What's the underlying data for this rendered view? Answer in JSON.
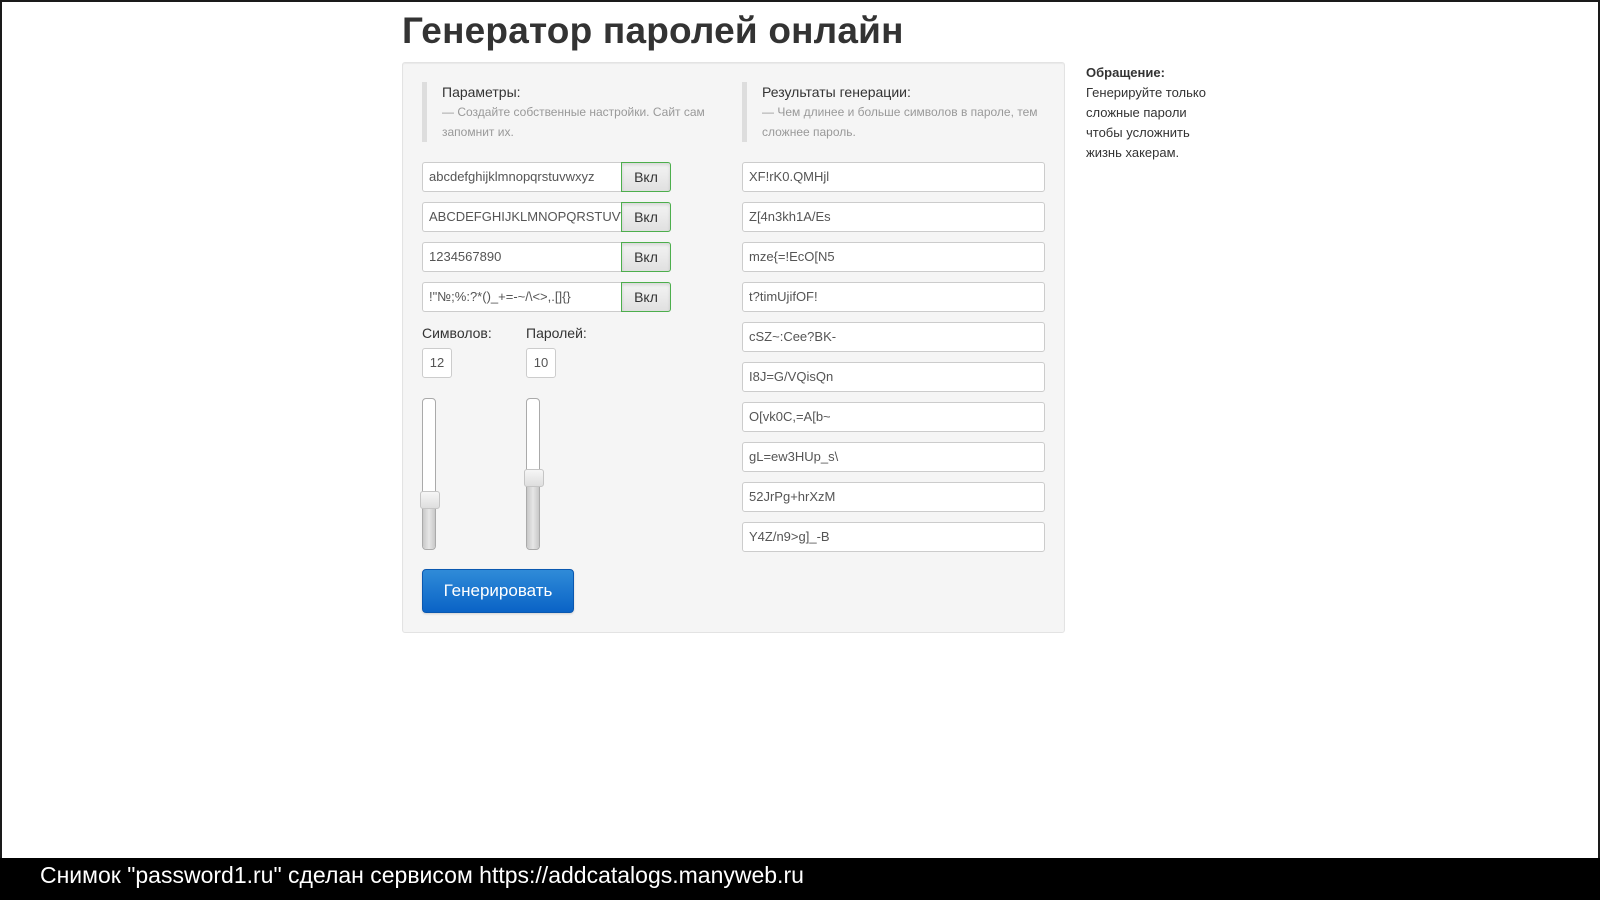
{
  "page": {
    "title": "Генератор паролей онлайн"
  },
  "params": {
    "title": "Параметры:",
    "subtitle": "— Создайте собственные настройки. Сайт сам запомнит их.",
    "charsets": [
      {
        "value": "abcdefghijklmnopqrstuvwxyz",
        "toggle_label": "Вкл"
      },
      {
        "value": "ABCDEFGHIJKLMNOPQRSTUVWXYZ",
        "toggle_label": "Вкл"
      },
      {
        "value": "1234567890",
        "toggle_label": "Вкл"
      },
      {
        "value": "!\"№;%:?*()_+=-~/\\<>,.[]{}",
        "toggle_label": "Вкл"
      }
    ],
    "length_label": "Символов:",
    "length_value": "12",
    "length_slider_fraction": 0.3,
    "count_label": "Паролей:",
    "count_value": "10",
    "count_slider_fraction": 0.47,
    "generate_label": "Генерировать"
  },
  "results": {
    "title": "Результаты генерации:",
    "subtitle": "— Чем длинее и больше символов в пароле, тем сложнее пароль.",
    "passwords": [
      "XF!rK0.QMHjl",
      "Z[4n3kh1A/Es",
      "mze{=!EcO[N5",
      "t?timUjifOF!",
      "cSZ~:Cee?BK-",
      "I8J=G/VQisQn",
      "O[vk0C,=A[b~",
      "gL=ew3HUp_s\\",
      "52JrPg+hrXzM",
      "Y4Z/n9>g]_-B"
    ]
  },
  "side": {
    "title": "Обращение:",
    "text": "Генерируйте только сложные пароли чтобы усложнить жизнь хакерам."
  },
  "caption": {
    "text": "Снимок \"password1.ru\" сделан сервисом https://addcatalogs.manyweb.ru"
  },
  "colors": {
    "primary_button": "#0a63c6",
    "toggle_border": "#4cae4c",
    "panel_bg": "#f5f5f5"
  }
}
